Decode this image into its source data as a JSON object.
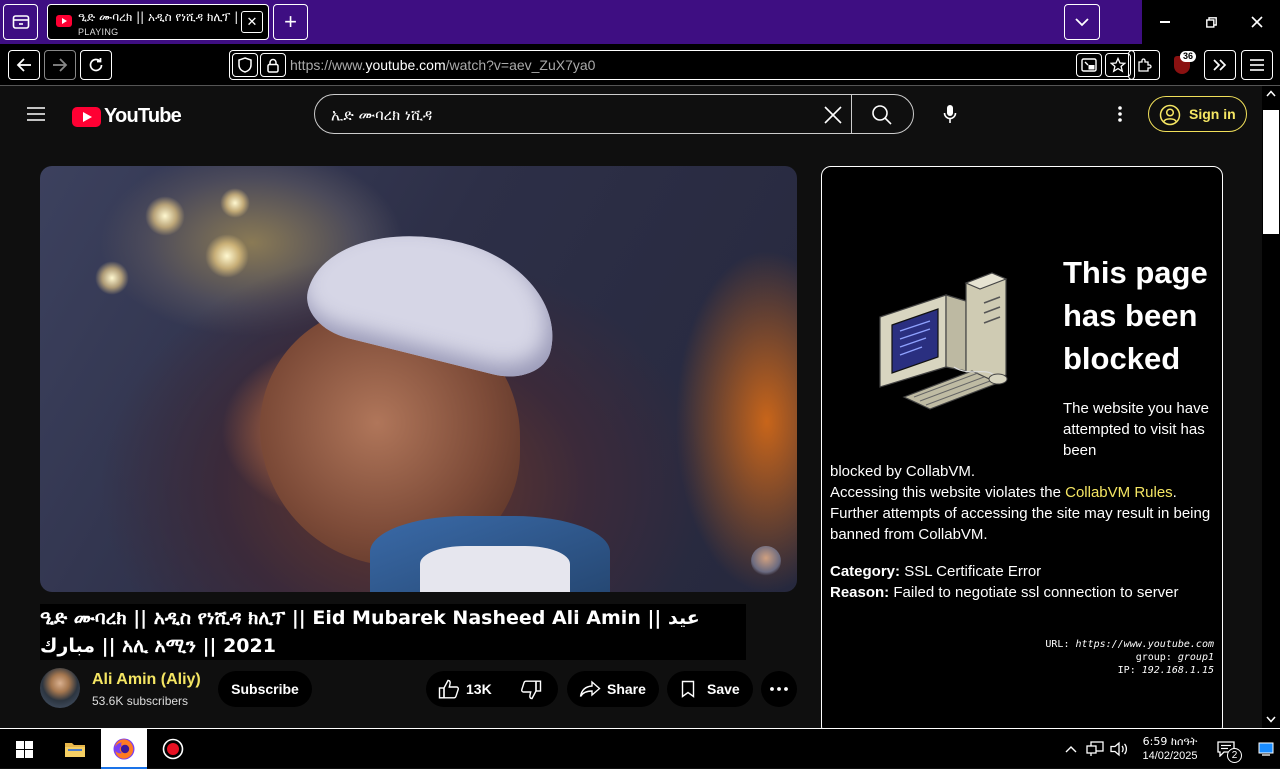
{
  "browser": {
    "tab": {
      "title": "ዒድ ሙባረክ || አዲስ የነሺዳ ክሊፕ || Eid Mubarek",
      "status": "PLAYING"
    },
    "url": {
      "prefix": "https://www.",
      "domain": "youtube.com",
      "path": "/watch?v=aev_ZuX7ya0"
    },
    "extension_badge": "36"
  },
  "youtube": {
    "logo_text": "YouTube",
    "search_query": "ኢድ ሙባረክ ነሺዳ",
    "sign_in_label": "Sign in",
    "video": {
      "title": "ዒድ ሙባረክ || አዲስ የነሺዳ ክሊፕ || Eid Mubarek Nasheed Ali Amin || عيد مبارك || አሊ አሚን || 2021",
      "channel": "Ali Amin (Aliy)",
      "subscribers": "53.6K subscribers",
      "subscribe_label": "Subscribe",
      "likes": "13K",
      "share_label": "Share",
      "save_label": "Save"
    }
  },
  "blocked_page": {
    "heading": "This page has been blocked",
    "message_1": "The website you have attempted to visit has been",
    "message_2": "blocked by CollabVM.",
    "message_3": "Accessing this website violates the",
    "rules_link": "CollabVM Rules",
    "message_4": "Further attempts of accessing the site may result in being banned from CollabVM.",
    "category_label": "Category:",
    "category_value": "SSL Certificate Error",
    "reason_label": "Reason:",
    "reason_value": "Failed to negotiate ssl connection to server",
    "url_line_label": "URL:",
    "url_line_value": "https://www.youtube.com",
    "group_line_label": "group:",
    "group_line_value": "group1",
    "ip_line_label": "IP:",
    "ip_line_value": "192.168.1.15"
  },
  "taskbar": {
    "time": "6:59 ከሰዓት",
    "date": "14/02/2025",
    "notification_count": "2"
  },
  "colors": {
    "tabstrip": "#3e0e82",
    "accent_yellow": "#f5e663",
    "yt_red": "#ff0033"
  }
}
